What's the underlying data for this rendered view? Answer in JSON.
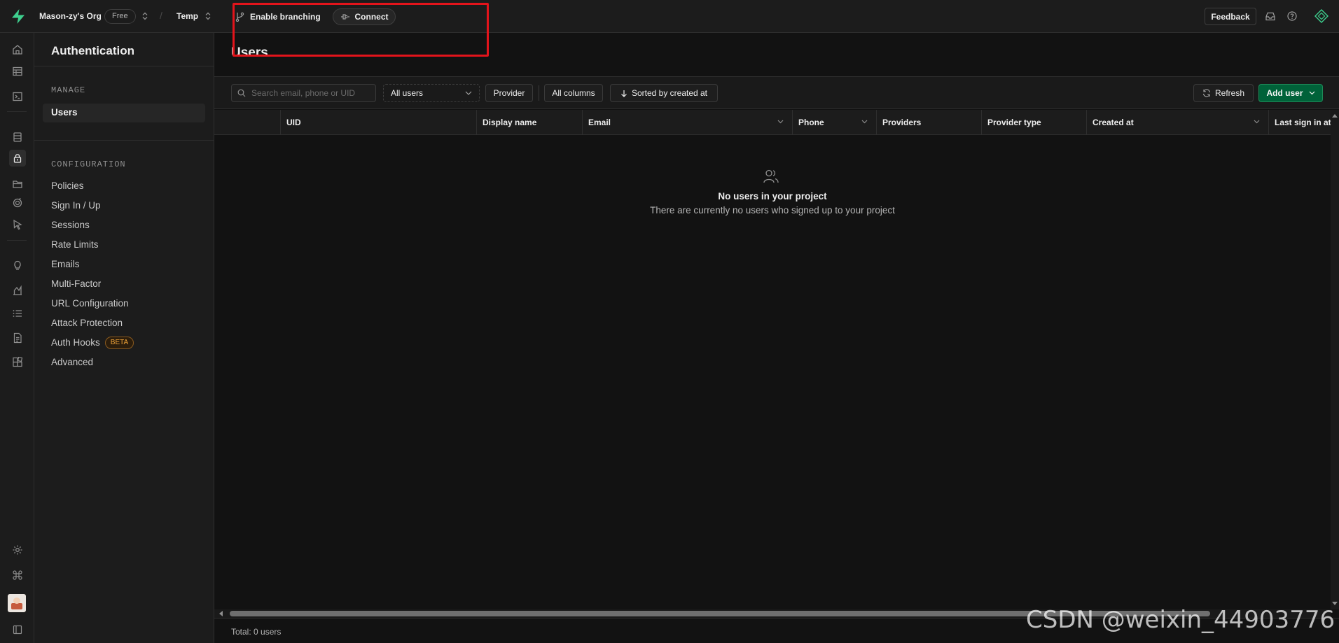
{
  "topbar": {
    "org_name": "Mason-zy's Org",
    "plan_badge": "Free",
    "separator": "/",
    "project_name": "Temp",
    "branching_label": "Enable branching",
    "connect_label": "Connect",
    "feedback_label": "Feedback"
  },
  "sidebar": {
    "title": "Authentication",
    "manage_label": "MANAGE",
    "manage_items": [
      {
        "label": "Users"
      }
    ],
    "config_label": "CONFIGURATION",
    "config_items": [
      {
        "label": "Policies"
      },
      {
        "label": "Sign In / Up"
      },
      {
        "label": "Sessions"
      },
      {
        "label": "Rate Limits"
      },
      {
        "label": "Emails"
      },
      {
        "label": "Multi-Factor"
      },
      {
        "label": "URL Configuration"
      },
      {
        "label": "Attack Protection"
      },
      {
        "label": "Auth Hooks",
        "badge": "BETA"
      },
      {
        "label": "Advanced"
      }
    ]
  },
  "main": {
    "page_title": "Users",
    "search_placeholder": "Search email, phone or UID",
    "filter_selected": "All users",
    "provider_label": "Provider",
    "columns_label": "All columns",
    "sort_label": "Sorted by created at",
    "refresh_label": "Refresh",
    "add_user_label": "Add user",
    "table_columns": [
      "UID",
      "Display name",
      "Email",
      "Phone",
      "Providers",
      "Provider type",
      "Created at",
      "Last sign in at"
    ],
    "empty_title": "No users in your project",
    "empty_subtitle": "There are currently no users who signed up to your project",
    "footer_total": "Total: 0 users"
  },
  "watermark": "CSDN @weixin_44903776",
  "colors": {
    "brand_green": "#3ecf8e",
    "add_user_bg": "#006239",
    "highlight_red": "#e3141b",
    "beta_orange": "#f0a43a"
  }
}
